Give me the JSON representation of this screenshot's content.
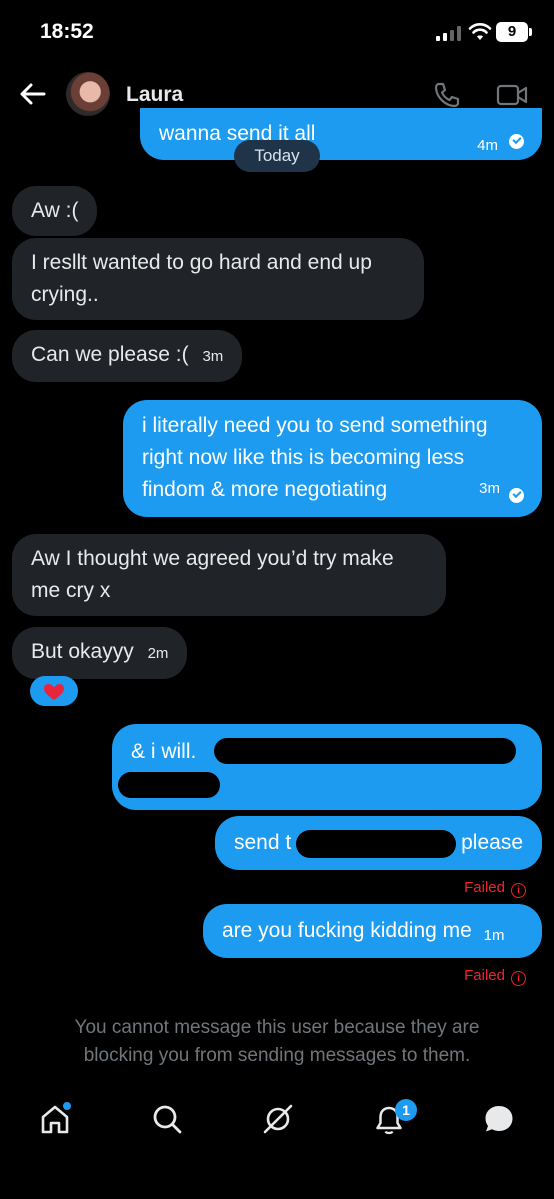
{
  "status_bar": {
    "time": "18:52",
    "battery": "9"
  },
  "header": {
    "contact_name": "Laura"
  },
  "date_separator": "Today",
  "messages": [
    {
      "dir": "out",
      "text": "wanna send it all",
      "time": "4m"
    },
    {
      "dir": "in",
      "text": "Aw :("
    },
    {
      "dir": "in",
      "line1": "I resllt wanted to go hard and end up",
      "line2": "crying.."
    },
    {
      "dir": "in",
      "text": "Can we please :(",
      "time": "3m"
    },
    {
      "dir": "out",
      "line1": "i literally need you to send something",
      "line2": "right now like this is becoming less",
      "line3": "findom & more negotiating",
      "time": "3m"
    },
    {
      "dir": "in",
      "line1": "Aw I thought we agreed you’d try make",
      "line2": "me cry x"
    },
    {
      "dir": "in",
      "text": "But okayyy",
      "time": "2m",
      "reaction": "❤️"
    },
    {
      "dir": "out",
      "text": "& i will."
    },
    {
      "dir": "out",
      "text_start": "send t",
      "text_end": "please",
      "status": "Failed"
    },
    {
      "dir": "out",
      "text": "are you fucking kidding me",
      "time": "1m",
      "status": "Failed"
    }
  ],
  "blocked_notice": {
    "line1": "You cannot message this user because they are",
    "line2": "blocking you from sending messages to them."
  },
  "bottom_nav": {
    "items": [
      "home-icon",
      "search-icon",
      "grok-icon",
      "notifications-icon",
      "messages-icon"
    ],
    "notification_count": "1"
  },
  "colors": {
    "accent": "#1d9bf0",
    "incoming_bubble": "#202327",
    "error": "#f4212e",
    "muted": "#71767b"
  }
}
